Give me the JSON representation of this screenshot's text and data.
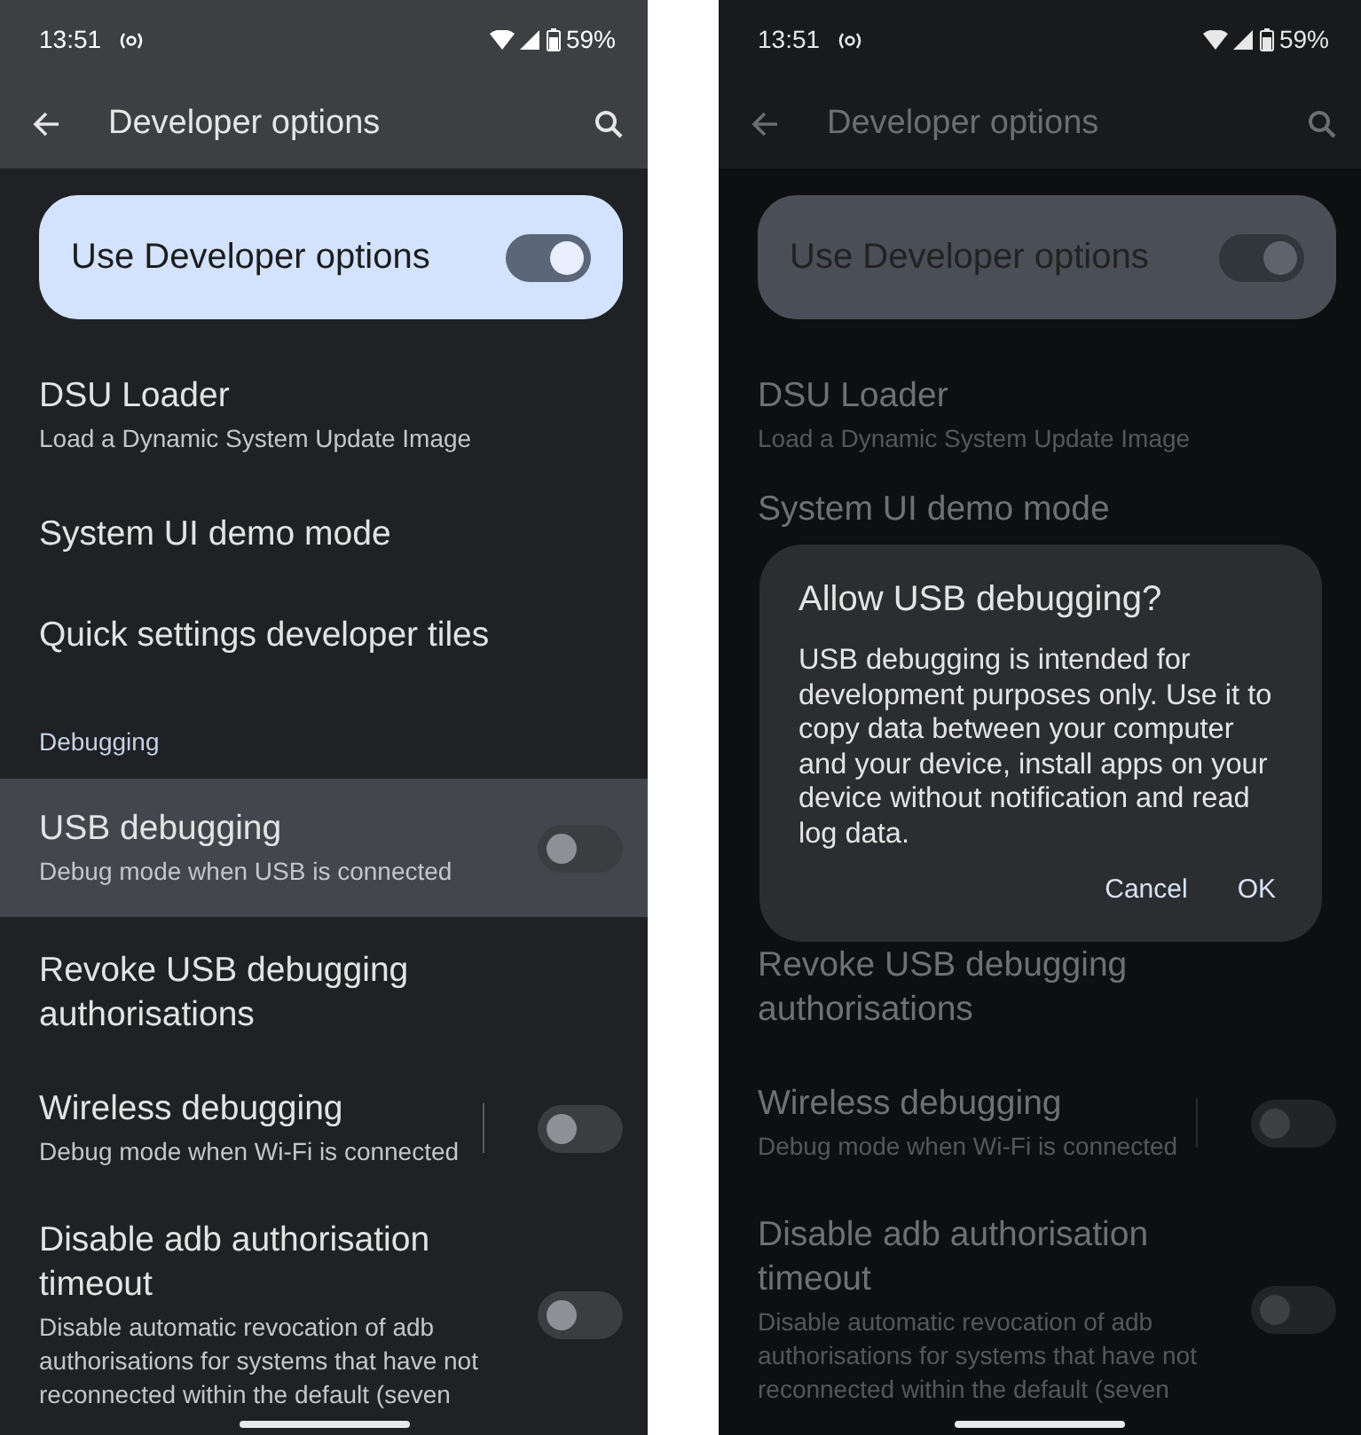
{
  "screens": [
    {
      "status": {
        "time": "13:51",
        "battery": "59%"
      },
      "app_bar": {
        "title": "Developer options"
      },
      "master": {
        "label": "Use Developer options",
        "on": true
      },
      "items": [
        {
          "kind": "item",
          "title": "DSU Loader",
          "subtitle": "Load a Dynamic System Update Image"
        },
        {
          "kind": "item",
          "title": "System UI demo mode"
        },
        {
          "kind": "item",
          "title": "Quick settings developer tiles"
        },
        {
          "kind": "header",
          "label": "Debugging"
        },
        {
          "kind": "toggle",
          "title": "USB debugging",
          "subtitle": "Debug mode when USB is connected",
          "on": false,
          "highlighted": true
        },
        {
          "kind": "item",
          "title": "Revoke USB debugging authorisations"
        },
        {
          "kind": "toggle",
          "title": "Wireless debugging",
          "subtitle": "Debug mode when Wi-Fi is connected",
          "on": false,
          "divider": true
        },
        {
          "kind": "toggle",
          "title": "Disable adb authorisation timeout",
          "subtitle": "Disable automatic revocation of adb authorisations for systems that have not reconnected within the default (seven",
          "on": false
        }
      ]
    },
    {
      "dimmed": true,
      "status": {
        "time": "13:51",
        "battery": "59%"
      },
      "app_bar": {
        "title": "Developer options"
      },
      "master": {
        "label": "Use Developer options",
        "on": true
      },
      "items": [
        {
          "kind": "item",
          "title": "DSU Loader",
          "subtitle": "Load a Dynamic System Update Image"
        },
        {
          "kind": "item",
          "title": "System UI demo mode"
        },
        {
          "kind": "gap"
        },
        {
          "kind": "item",
          "title": "Revoke USB debugging authorisations"
        },
        {
          "kind": "toggle",
          "title": "Wireless debugging",
          "subtitle": "Debug mode when Wi-Fi is connected",
          "on": false,
          "divider": true
        },
        {
          "kind": "toggle",
          "title": "Disable adb authorisation timeout",
          "subtitle": "Disable automatic revocation of adb authorisations for systems that have not reconnected within the default (seven",
          "on": false
        }
      ],
      "dialog": {
        "title": "Allow USB debugging?",
        "message": "USB debugging is intended for development purposes only. Use it to copy data between your computer and your device, install apps on your device without notification and read log data.",
        "buttons": [
          "Cancel",
          "OK"
        ]
      }
    }
  ]
}
